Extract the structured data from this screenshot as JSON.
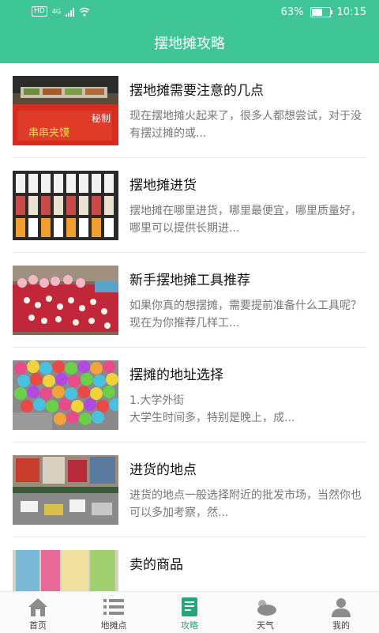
{
  "status": {
    "battery": "63%",
    "time": "10:15",
    "network_badge": "HD",
    "signal_type": "4G",
    "battery_level": 0.63
  },
  "header": {
    "title": "摆地摊攻略"
  },
  "articles": [
    {
      "title": "摆地摊需要注意的几点",
      "summary": "现在摆地摊火起来了，很多人都想尝试，对于没有摆过摊的或...",
      "image_icon": "food-stall-image"
    },
    {
      "title": "摆地摊进货",
      "summary": "摆地摊在哪里进货，哪里最便宜，哪里质量好，哪里可以提供长期进...",
      "image_icon": "socks-stall-image"
    },
    {
      "title": "新手摆地摊工具推荐",
      "summary": "如果你真的想摆摊，需要提前准备什么工具呢？现在为你推荐几样工...",
      "image_icon": "toys-stall-image"
    },
    {
      "title": "摆摊的地址选择",
      "summary": "1.大学外街\n大学生时间多，特别是晚上，成...",
      "image_icon": "balloon-stall-image"
    },
    {
      "title": "进货的地点",
      "summary": "进货的地点一般选择附近的批发市场，当然你也可以多加考察，然...",
      "image_icon": "market-street-image"
    },
    {
      "title": "卖的商品",
      "summary": "",
      "image_icon": "goods-image"
    }
  ],
  "tabs": [
    {
      "label": "首页",
      "icon": "home-icon",
      "active": false
    },
    {
      "label": "地摊点",
      "icon": "list-icon",
      "active": false
    },
    {
      "label": "攻略",
      "icon": "book-icon",
      "active": true
    },
    {
      "label": "天气",
      "icon": "weather-icon",
      "active": false
    },
    {
      "label": "我的",
      "icon": "user-icon",
      "active": false
    }
  ],
  "colors": {
    "primary": "#3fc596",
    "active_tab": "#28a67a",
    "inactive_tab": "#8c8c8c"
  }
}
